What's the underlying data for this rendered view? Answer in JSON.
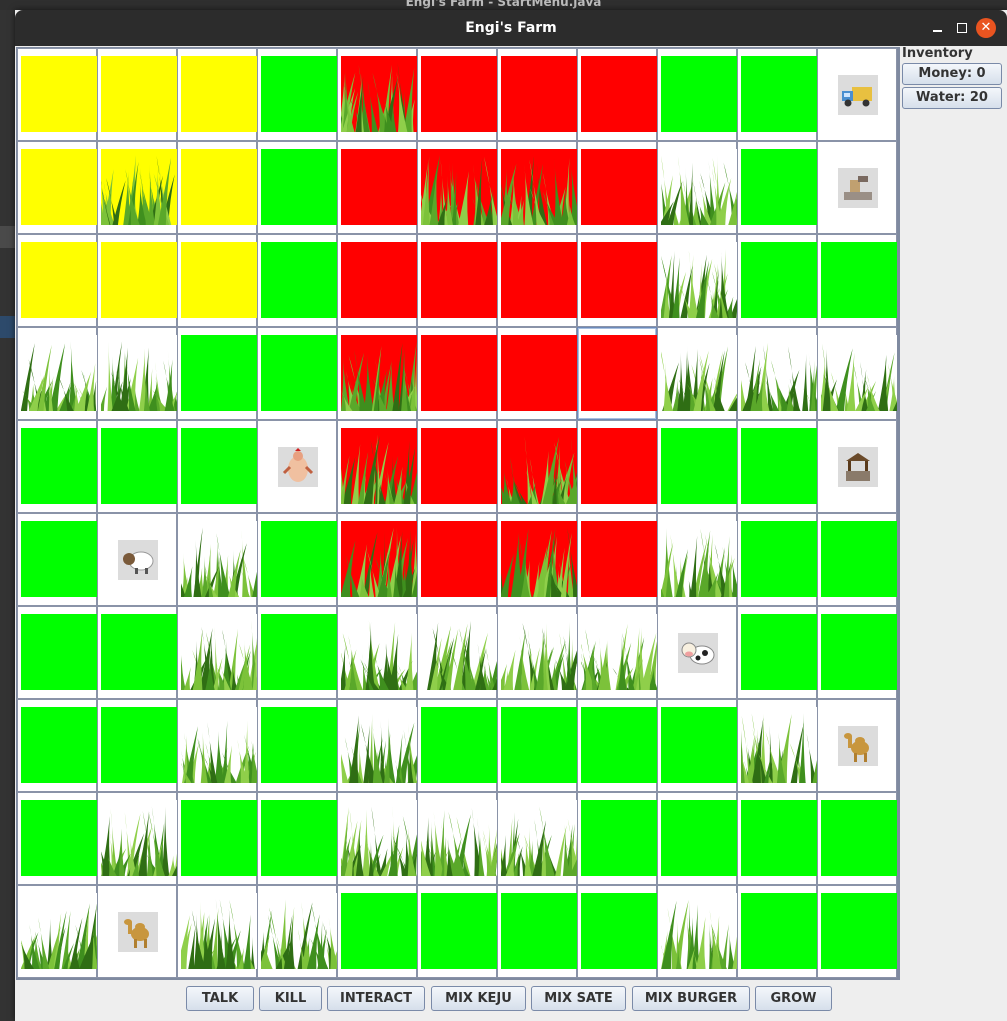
{
  "background_title": "Engi's Farm - StartMenu.java",
  "window": {
    "title": "Engi's Farm"
  },
  "inventory": {
    "label": "Inventory",
    "money_label": "Money: 0",
    "water_label": "Water: 20"
  },
  "actions": [
    "TALK",
    "KILL",
    "INTERACT",
    "MIX KEJU",
    "MIX SATE",
    "MIX BURGER",
    "GROW"
  ],
  "legend_colors": {
    "yellow": "#ffff00",
    "green": "#00ff00",
    "red": "#ff0000"
  },
  "grid": {
    "selected": [
      3,
      7
    ],
    "rows": [
      [
        "yellow",
        "yellow",
        "yellow",
        "green",
        "red-grass",
        "red",
        "red",
        "red",
        "green",
        "green",
        "truck"
      ],
      [
        "yellow",
        "yellow-grass",
        "yellow",
        "green",
        "red",
        "red-grass",
        "red-grass",
        "red",
        "green-grass",
        "green",
        "mixer"
      ],
      [
        "yellow",
        "yellow",
        "yellow",
        "green",
        "red",
        "red",
        "red",
        "red",
        "green-grass",
        "green",
        "green"
      ],
      [
        "green-grass",
        "green-grass",
        "green",
        "green",
        "red-grass",
        "red",
        "red",
        "red",
        "green-grass",
        "green-grass",
        "green-grass"
      ],
      [
        "green",
        "green",
        "green",
        "chicken",
        "red-grass",
        "red",
        "red-grass",
        "red",
        "green",
        "green",
        "well"
      ],
      [
        "green",
        "sheep",
        "green-grass",
        "green",
        "red-grass",
        "red",
        "red-grass",
        "red",
        "green-grass",
        "green",
        "green"
      ],
      [
        "green",
        "green",
        "green-grass",
        "green",
        "green-grass",
        "green-grass",
        "green-grass",
        "green-grass",
        "cow",
        "green",
        "green"
      ],
      [
        "green",
        "green",
        "green-grass",
        "green",
        "green-grass",
        "green",
        "green",
        "green",
        "green",
        "green-grass",
        "camel"
      ],
      [
        "green",
        "green-grass",
        "green",
        "green",
        "green-grass",
        "green-grass",
        "green-grass",
        "green",
        "green",
        "green",
        "green"
      ],
      [
        "green-grass",
        "camel",
        "green-grass",
        "green-grass",
        "green",
        "green",
        "green",
        "green",
        "green-grass",
        "green",
        "green"
      ]
    ]
  }
}
